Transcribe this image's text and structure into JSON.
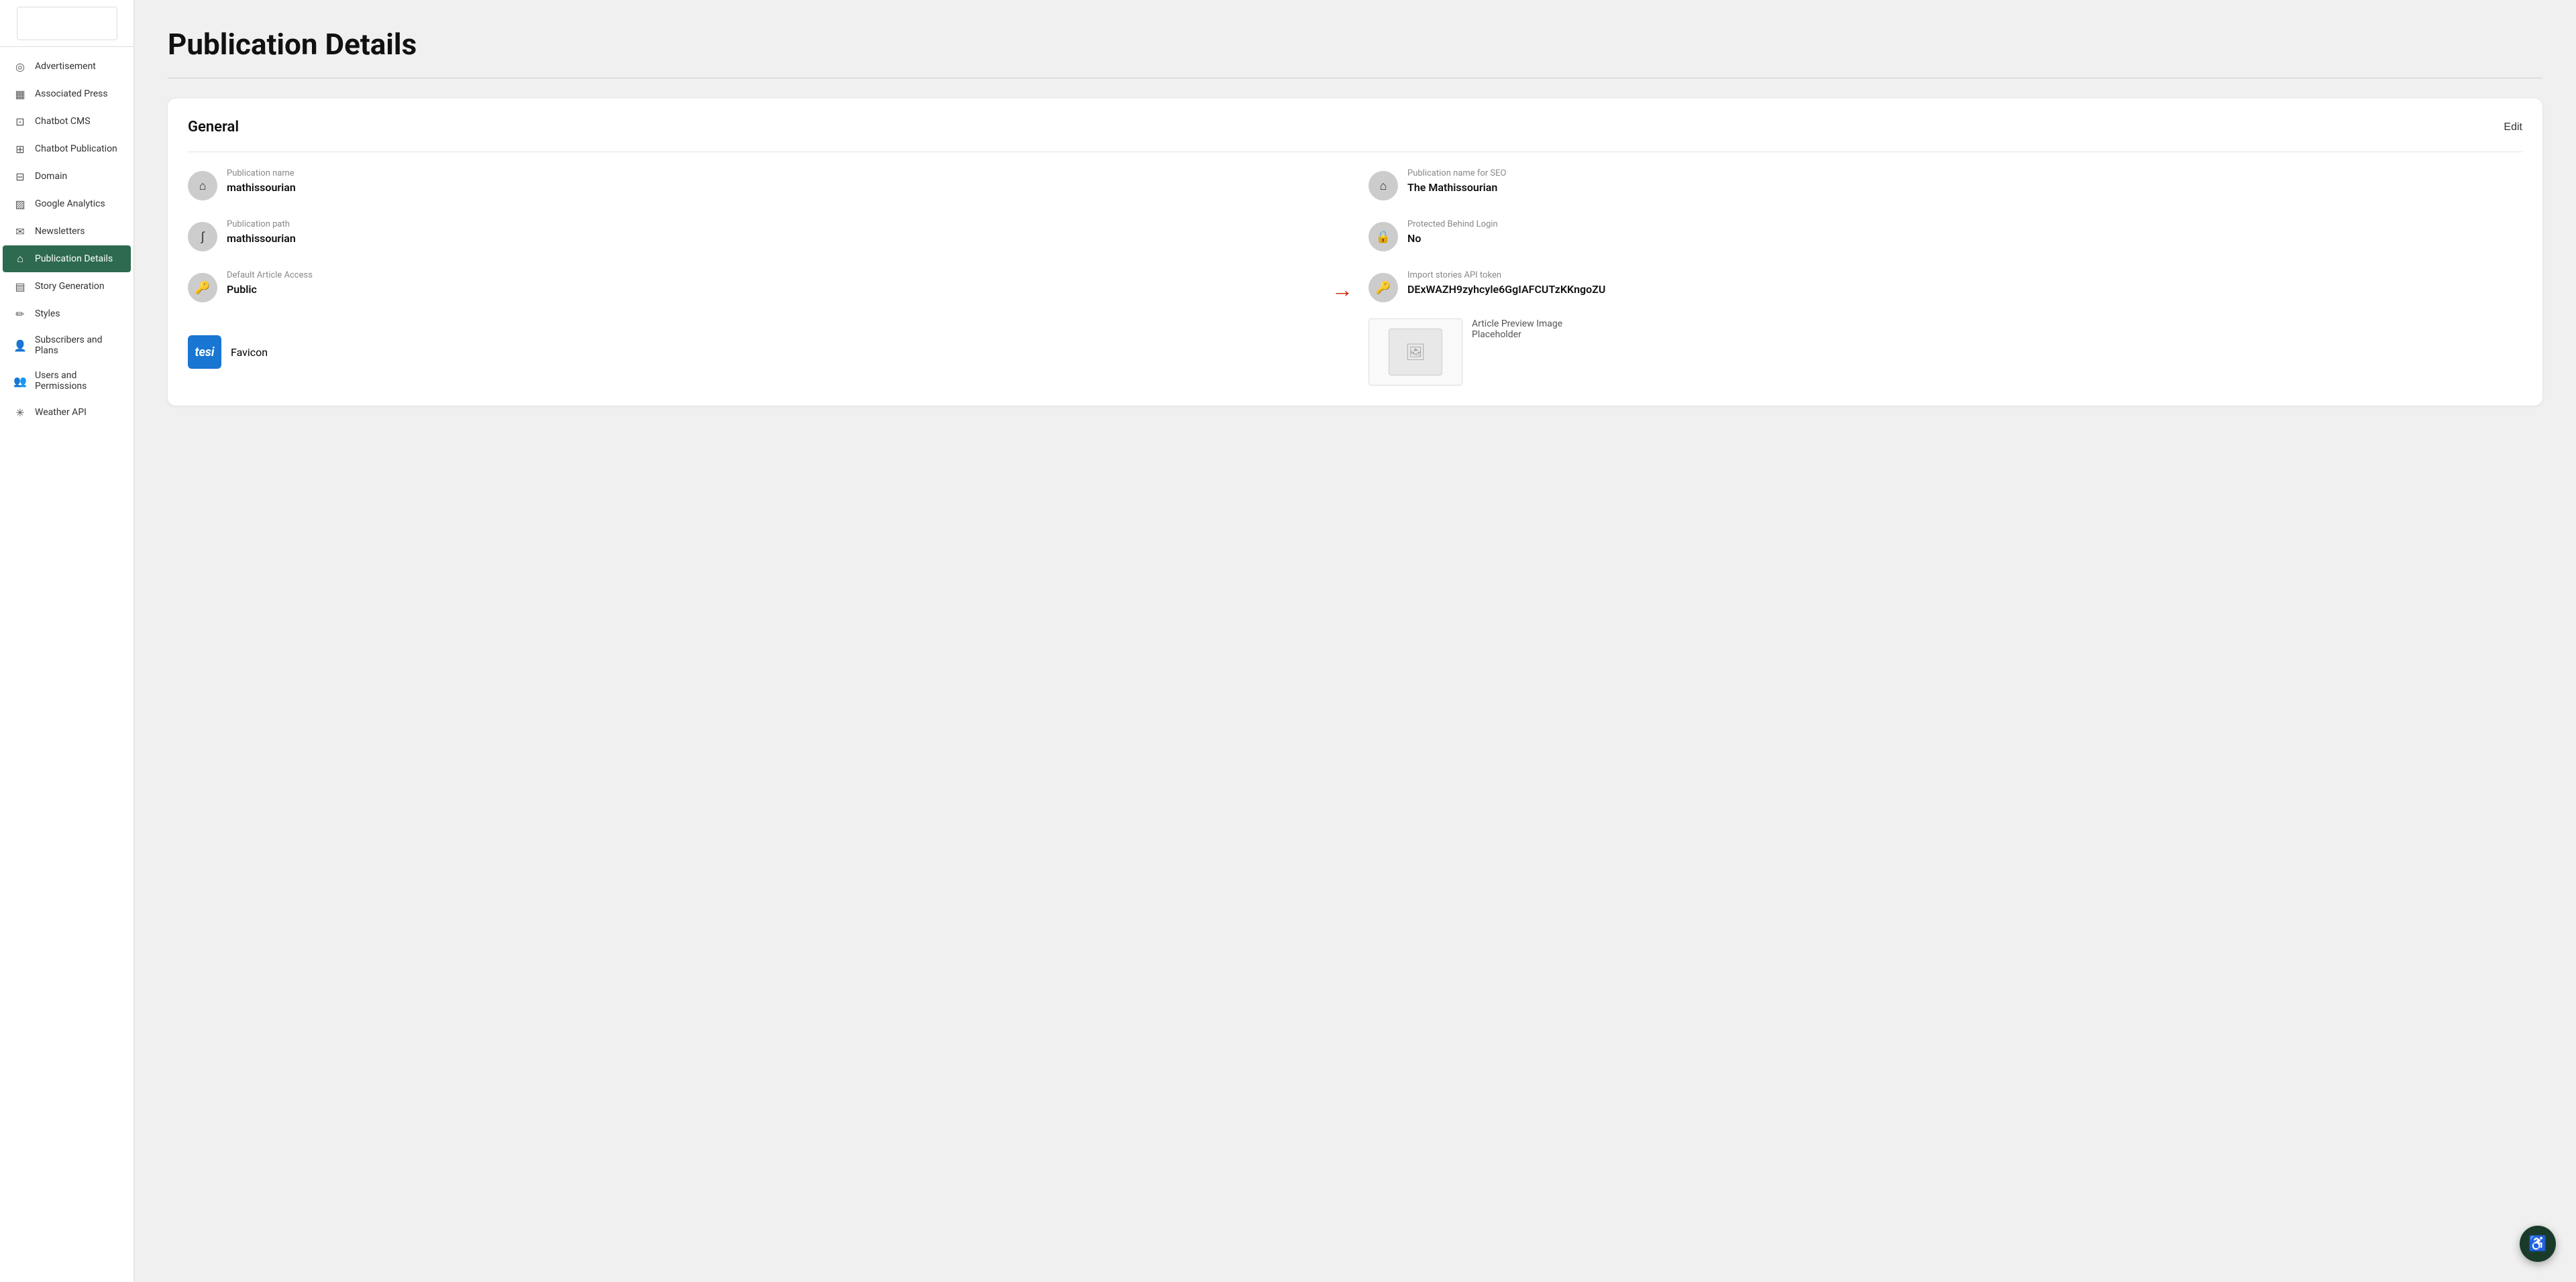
{
  "sidebar": {
    "items": [
      {
        "id": "advertisement",
        "label": "Advertisement",
        "icon": "◎",
        "active": false
      },
      {
        "id": "associated-press",
        "label": "Associated Press",
        "icon": "▦",
        "active": false
      },
      {
        "id": "chatbot-cms",
        "label": "Chatbot CMS",
        "icon": "⊡",
        "active": false
      },
      {
        "id": "chatbot-publication",
        "label": "Chatbot Publication",
        "icon": "⊞",
        "active": false
      },
      {
        "id": "domain",
        "label": "Domain",
        "icon": "⊟",
        "active": false
      },
      {
        "id": "google-analytics",
        "label": "Google Analytics",
        "icon": "▨",
        "active": false
      },
      {
        "id": "newsletters",
        "label": "Newsletters",
        "icon": "✉",
        "active": false
      },
      {
        "id": "publication-details",
        "label": "Publication Details",
        "icon": "⌂",
        "active": true
      },
      {
        "id": "story-generation",
        "label": "Story Generation",
        "icon": "▤",
        "active": false
      },
      {
        "id": "styles",
        "label": "Styles",
        "icon": "✏",
        "active": false
      },
      {
        "id": "subscribers-and-plans",
        "label": "Subscribers and Plans",
        "icon": "👤",
        "active": false
      },
      {
        "id": "users-and-permissions",
        "label": "Users and Permissions",
        "icon": "👥",
        "active": false
      },
      {
        "id": "weather-api",
        "label": "Weather API",
        "icon": "✳",
        "active": false
      }
    ]
  },
  "page": {
    "title": "Publication Details"
  },
  "general_section": {
    "title": "General",
    "edit_label": "Edit",
    "fields": [
      {
        "id": "publication-name",
        "label": "Publication name",
        "value": "mathissourian",
        "icon": "house"
      },
      {
        "id": "publication-name-seo",
        "label": "Publication name for SEO",
        "value": "The Mathissourian",
        "icon": "house"
      },
      {
        "id": "publication-path",
        "label": "Publication path",
        "value": "mathissourian",
        "icon": "path"
      },
      {
        "id": "protected-behind-login",
        "label": "Protected Behind Login",
        "value": "No",
        "icon": "lock"
      },
      {
        "id": "default-article-access",
        "label": "Default Article Access",
        "value": "Public",
        "icon": "key"
      },
      {
        "id": "import-stories-api-token",
        "label": "Import stories API token",
        "value": "DExWAZH9zyhcyle6GgIAFCUTzKKngoZU",
        "icon": "key",
        "has_arrow": true
      }
    ],
    "favicon_label": "Favicon",
    "favicon_text": "tesi",
    "article_preview_label": "Article Preview Image\nPlaceholder"
  }
}
